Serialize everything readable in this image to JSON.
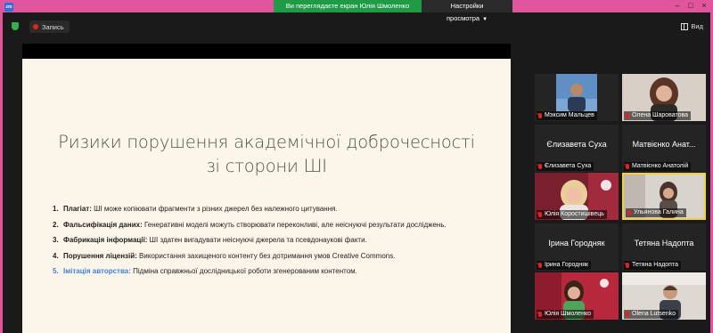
{
  "app": {
    "icon_text": "zm",
    "minimize": "–",
    "maximize": "□",
    "close": "×"
  },
  "share_banner": {
    "message": "Ви переглядаєте екран Юлія Шмоленко",
    "options": "Настройки просмотра",
    "options_caret": "▼"
  },
  "toolbar": {
    "record_label": "Запись",
    "view_label": "Вид"
  },
  "slide": {
    "title_line1": "Ризики порушення академічної доброчесності",
    "title_line2": "зі сторони ШІ",
    "items": [
      {
        "num": "1.",
        "term": "Плагіат:",
        "text": " ШІ може копіювати фрагменти з різних джерел без належного цитування."
      },
      {
        "num": "2.",
        "term": "Фальсифікація даних:",
        "text": " Генеративні моделі можуть створювати переконливі, але неіснуючі результати досліджень."
      },
      {
        "num": "3.",
        "term": "Фабрикація інформації:",
        "text": " ШІ здатен вигадувати неіснуючі джерела та псевдонаукові факти."
      },
      {
        "num": "4.",
        "term": "Порушення ліцензій:",
        "text": " Використання захищеного контенту без дотримання умов Creative Commons."
      },
      {
        "num": "5.",
        "term": "Імітація авторства:",
        "text": " Підміна справжньої дослідницької роботи згенерованим контентом."
      }
    ]
  },
  "participants": [
    {
      "label": "Мэксим Мальцев",
      "big_name": "",
      "photo": "man-blue-bg"
    },
    {
      "label": "Олена Шароватова",
      "big_name": "",
      "photo": "woman-dark-hair"
    },
    {
      "label": "Єлизавета Суха",
      "big_name": "Єлизавета Суха",
      "photo": ""
    },
    {
      "label": "Матвієнко Анатолій",
      "big_name": "Матвієнко Анат...",
      "photo": ""
    },
    {
      "label": "Юлія Коростишівець",
      "big_name": "",
      "photo": "woman-blonde-pink"
    },
    {
      "label": "Ульянова Галина",
      "big_name": "",
      "photo": "woman-room",
      "active": true
    },
    {
      "label": "Ірина Городняк",
      "big_name": "Ірина Городняк",
      "photo": ""
    },
    {
      "label": "Тетяна Надопта",
      "big_name": "Тетяна Надопта",
      "photo": ""
    },
    {
      "label": "Юлія Шмоленко",
      "big_name": "",
      "photo": "woman-pink-bg"
    },
    {
      "label": "Olena Lutsenko",
      "big_name": "",
      "photo": "man-light-room"
    }
  ],
  "colors": {
    "accent_green": "#1f9a45",
    "title_green": "#4a5a3c",
    "highlight_blue": "#3f7fd9",
    "active_border": "#f2d23c",
    "frame_pink": "#e0559c"
  }
}
